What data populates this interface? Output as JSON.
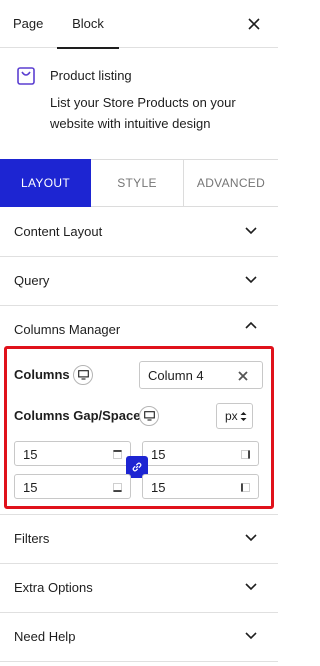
{
  "top_tabs": {
    "page_label": "Page",
    "block_label": "Block"
  },
  "block": {
    "name": "Product listing",
    "description": "List your Store Products on your website with intuitive design",
    "icon": "shopping-bag-icon",
    "accent": "#5b3fd1"
  },
  "panel_tabs": [
    {
      "label": "LAYOUT",
      "active": true
    },
    {
      "label": "STYLE",
      "active": false
    },
    {
      "label": "ADVANCED",
      "active": false
    }
  ],
  "sections": {
    "content_layout": "Content Layout",
    "query": "Query",
    "columns_manager": "Columns Manager",
    "filters": "Filters",
    "extra_options": "Extra Options",
    "need_help": "Need Help"
  },
  "columns_manager": {
    "columns_label": "Columns",
    "columns_value": "Column 4",
    "gap_label": "Columns Gap/Space",
    "unit_value": "px",
    "gap_top": "15",
    "gap_right": "15",
    "gap_bottom": "15",
    "gap_left": "15"
  },
  "colors": {
    "primary": "#1d25d2",
    "highlight_border": "#e0111b"
  }
}
